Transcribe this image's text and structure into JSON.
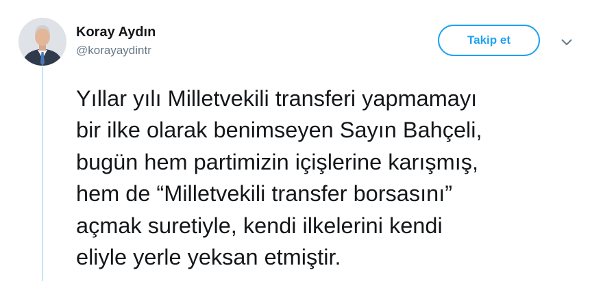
{
  "author": {
    "display_name": "Koray Aydın",
    "handle": "@korayaydintr"
  },
  "actions": {
    "follow_label": "Takip et",
    "more_icon": "chevron-down-icon"
  },
  "tweet": {
    "text": "Yıllar yılı Milletvekili transferi yapmamayı\nbir ilke olarak benimseyen Sayın Bahçeli,\nbugün hem partimizin içişlerine karışmış,\nhem de “Milletvekili transfer borsasını”\naçmak suretiyle, kendi ilkelerini kendi\neliyle yerle yeksan etmiştir."
  },
  "colors": {
    "accent": "#1da1f2",
    "text": "#14171a",
    "secondary_text": "#657786",
    "thread_line": "#c4e3f7"
  }
}
